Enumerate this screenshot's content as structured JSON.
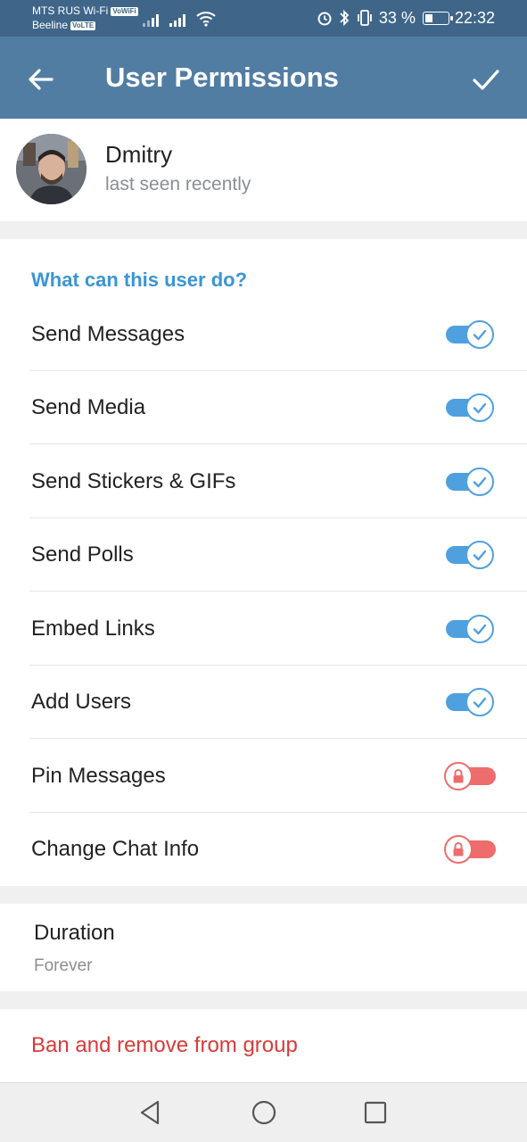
{
  "status_bar": {
    "carrier1": "MTS RUS Wi-Fi",
    "carrier1_badge": "VoWiFi",
    "carrier2": "Beeline",
    "carrier2_badge": "VoLTE",
    "battery_text": "33 %",
    "battery_level": 0.33,
    "time": "22:32",
    "icons": [
      "signal-icon",
      "signal-icon",
      "wifi-icon",
      "alarm-icon",
      "bluetooth-icon",
      "vibrate-icon",
      "battery-icon"
    ]
  },
  "app_bar": {
    "title": "User Permissions",
    "back_icon": "arrow-back-icon",
    "done_icon": "checkmark-icon"
  },
  "user": {
    "name": "Dmitry",
    "status": "last seen recently"
  },
  "permissions": {
    "header": "What can this user do?",
    "items": [
      {
        "label": "Send Messages",
        "state": "on"
      },
      {
        "label": "Send Media",
        "state": "on"
      },
      {
        "label": "Send Stickers & GIFs",
        "state": "on"
      },
      {
        "label": "Send Polls",
        "state": "on"
      },
      {
        "label": "Embed Links",
        "state": "on"
      },
      {
        "label": "Add Users",
        "state": "on"
      },
      {
        "label": "Pin Messages",
        "state": "locked"
      },
      {
        "label": "Change Chat Info",
        "state": "locked"
      }
    ]
  },
  "duration": {
    "label": "Duration",
    "value": "Forever"
  },
  "ban": {
    "label": "Ban and remove from group"
  },
  "colors": {
    "app_bar": "#527da3",
    "status_bar": "#3f6689",
    "accent": "#4fa0df",
    "header_text": "#3a95d5",
    "locked": "#ee6c6c",
    "danger": "#d93a3a"
  }
}
